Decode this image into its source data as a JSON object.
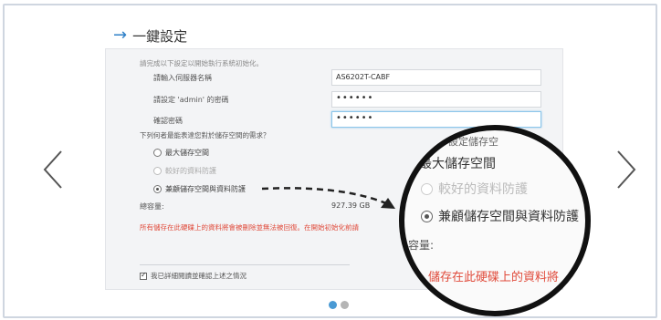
{
  "header": {
    "title": "一鍵設定"
  },
  "form": {
    "intro": "請完成以下設定以開始執行系統初始化。",
    "server_name_label": "請輸入伺服器名稱",
    "server_name_value": "AS6202T-CABF",
    "admin_password_label": "請設定 'admin' 的密碼",
    "admin_password_value": "••••••",
    "confirm_password_label": "確認密碼",
    "confirm_password_value": "••••••",
    "question": "下列何者最能表達您對於儲存空間的需求？",
    "options": [
      {
        "label": "最大儲存空間",
        "selected": false,
        "disabled": false
      },
      {
        "label": "較好的資料防護",
        "selected": false,
        "disabled": true
      },
      {
        "label": "兼顧儲存空間與資料防護",
        "selected": true,
        "disabled": false
      }
    ],
    "capacity_label": "總容量:",
    "capacity_value": "927.39 GB",
    "warning": "所有儲存在此硬碟上的資料將會被刪除並無法被回復。在開始初始化前請",
    "confirm_label": "我已詳細閱讀並確認上述之情況",
    "confirm_checked": true
  },
  "magnifier": {
    "top_fragment": "設定儲存空",
    "option_max": "最大儲存空間",
    "option_protect": "較好的資料防護",
    "option_balance": "兼顧儲存空間與資料防護",
    "capacity_fragment": "容量:",
    "warning_fragment": "儲存在此硬碟上的資料將"
  },
  "pager": {
    "active_color": "#4a9ad4",
    "inactive_color": "#b5b5b5"
  },
  "colors": {
    "accent": "#2f80c8",
    "warning": "#e04a3a"
  }
}
